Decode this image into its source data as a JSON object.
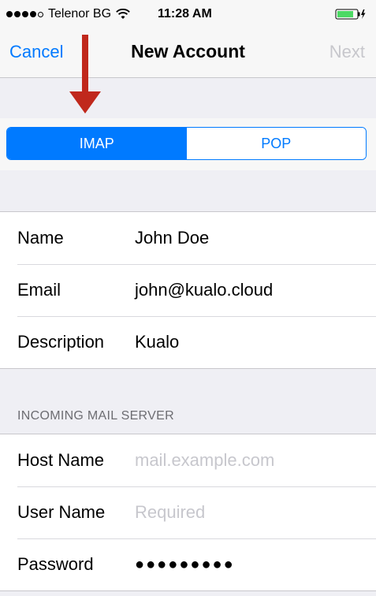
{
  "status_bar": {
    "carrier": "Telenor BG",
    "time": "11:28 AM"
  },
  "nav": {
    "cancel_label": "Cancel",
    "title": "New Account",
    "next_label": "Next"
  },
  "segmented": {
    "options": [
      "IMAP",
      "POP"
    ],
    "selected": "IMAP"
  },
  "account_fields": [
    {
      "label": "Name",
      "value": "John Doe"
    },
    {
      "label": "Email",
      "value": "john@kualo.cloud"
    },
    {
      "label": "Description",
      "value": "Kualo"
    }
  ],
  "incoming": {
    "header": "INCOMING MAIL SERVER",
    "host_label": "Host Name",
    "host_placeholder": "mail.example.com",
    "user_label": "User Name",
    "user_placeholder": "Required",
    "password_label": "Password",
    "password_value": "●●●●●●●●●"
  },
  "colors": {
    "accent": "#007aff",
    "arrow": "#c0281c",
    "background": "#efeff4",
    "placeholder": "#c7c7cd"
  }
}
